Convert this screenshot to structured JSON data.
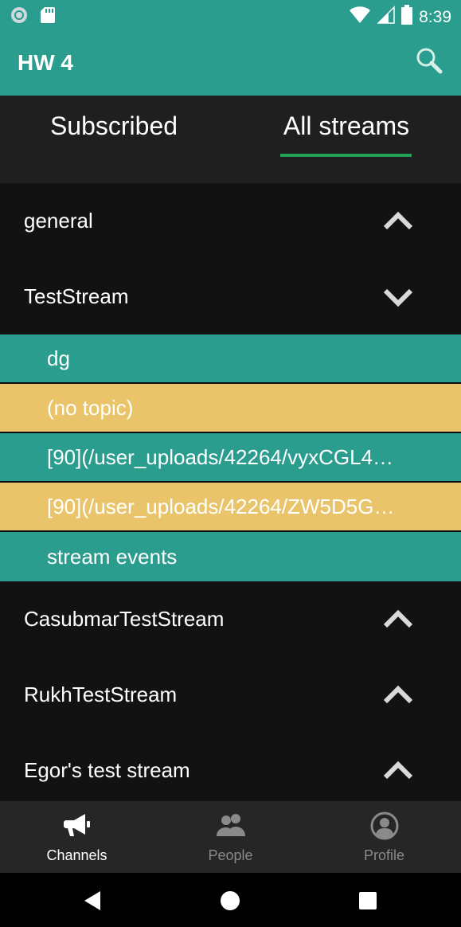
{
  "status_bar": {
    "time": "8:39",
    "icons": [
      "sync-icon",
      "sd-card-icon",
      "wifi-icon",
      "cell-signal-icon",
      "battery-icon"
    ]
  },
  "app_bar": {
    "title": "HW 4",
    "search_icon": "search-icon"
  },
  "tabs": [
    {
      "label": "Subscribed",
      "selected": false
    },
    {
      "label": "All streams",
      "selected": true
    }
  ],
  "streams": [
    {
      "name": "general",
      "expanded": false,
      "chevron": "chevron-up"
    },
    {
      "name": "TestStream",
      "expanded": true,
      "chevron": "chevron-down"
    },
    {
      "name": "CasubmarTestStream",
      "expanded": false,
      "chevron": "chevron-up"
    },
    {
      "name": "RukhTestStream",
      "expanded": false,
      "chevron": "chevron-up"
    },
    {
      "name": "Egor's test stream",
      "expanded": false,
      "chevron": "chevron-up"
    }
  ],
  "topics": [
    {
      "label": "dg",
      "color": "#2a9d8f"
    },
    {
      "label": "(no topic)",
      "color": "#e9c46a"
    },
    {
      "label": "[90](/user_uploads/42264/vyxCGL4…",
      "color": "#2a9d8f"
    },
    {
      "label": "[90](/user_uploads/42264/ZW5D5G…",
      "color": "#e9c46a"
    },
    {
      "label": "stream events",
      "color": "#2a9d8f"
    }
  ],
  "bottom_nav": [
    {
      "label": "Channels",
      "icon": "megaphone-icon",
      "active": true
    },
    {
      "label": "People",
      "icon": "people-icon",
      "active": false
    },
    {
      "label": "Profile",
      "icon": "account-circle-icon",
      "active": false
    }
  ],
  "colors": {
    "accent": "#2a9d8f",
    "topic_alt": "#e9c46a",
    "tab_indicator": "#22a05a",
    "background": "#121212",
    "nav_inactive": "#8a8a8a"
  }
}
